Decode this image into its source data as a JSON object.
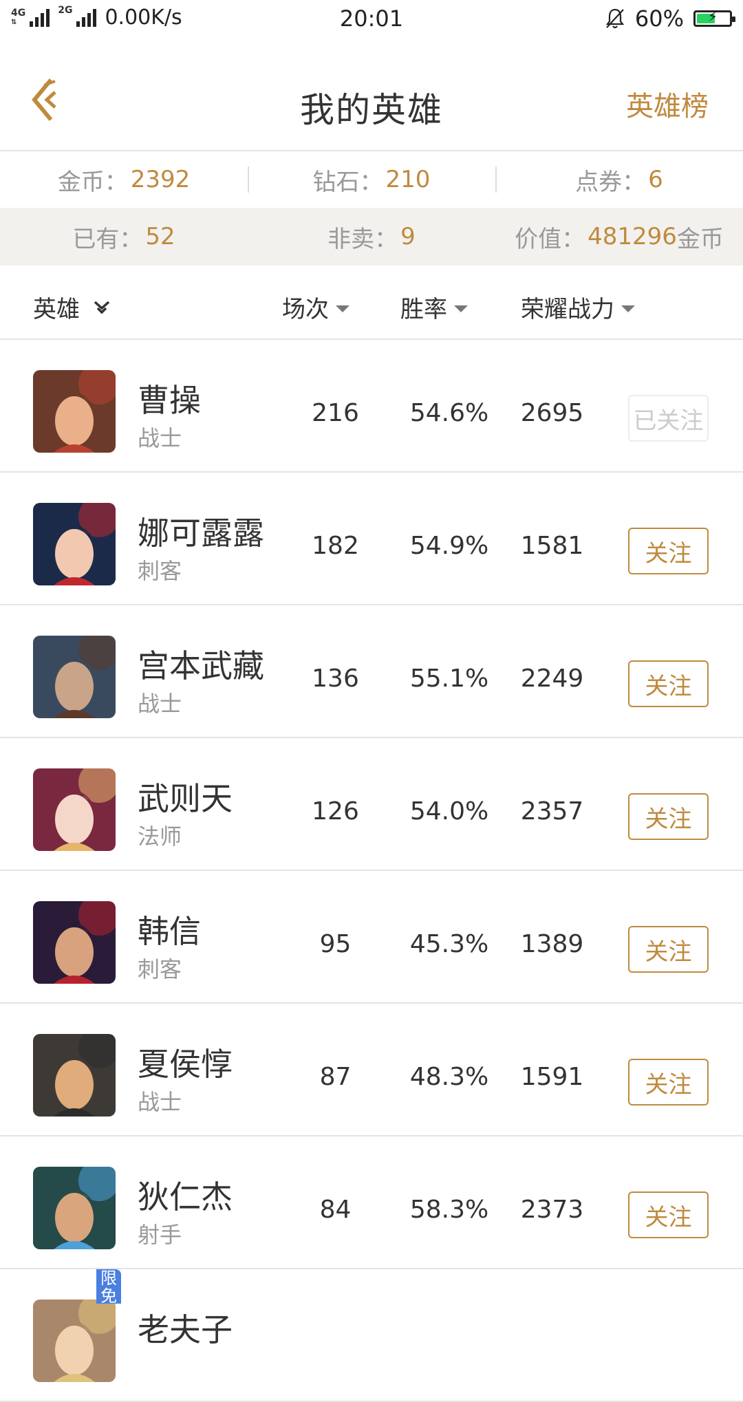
{
  "status_bar": {
    "net1": "4G",
    "net2": "4G",
    "net3": "2G",
    "speed": "0.00K/s",
    "time": "20:01",
    "battery": "60%",
    "battery_level": 0.6
  },
  "nav": {
    "title": "我的英雄",
    "right_link": "英雄榜"
  },
  "stats": {
    "gold_label": "金币：",
    "gold": "2392",
    "diamond_label": "钻石：",
    "diamond": "210",
    "voucher_label": "点券：",
    "voucher": "6",
    "owned_label": "已有：",
    "owned": "52",
    "notsale_label": "非卖：",
    "notsale": "9",
    "value_label": "价值：",
    "value": "481296",
    "value_suffix": "金币"
  },
  "table_header": {
    "hero": "英雄",
    "games": "场次",
    "winrate": "胜率",
    "power": "荣耀战力"
  },
  "heroes": [
    {
      "name": "曹操",
      "role": "战士",
      "games": "216",
      "winrate": "54.6%",
      "power": "2695",
      "follow": "已关注",
      "followed": true
    },
    {
      "name": "娜可露露",
      "role": "刺客",
      "games": "182",
      "winrate": "54.9%",
      "power": "1581",
      "follow": "关注",
      "followed": false
    },
    {
      "name": "宫本武藏",
      "role": "战士",
      "games": "136",
      "winrate": "55.1%",
      "power": "2249",
      "follow": "关注",
      "followed": false
    },
    {
      "name": "武则天",
      "role": "法师",
      "games": "126",
      "winrate": "54.0%",
      "power": "2357",
      "follow": "关注",
      "followed": false
    },
    {
      "name": "韩信",
      "role": "刺客",
      "games": "95",
      "winrate": "45.3%",
      "power": "1389",
      "follow": "关注",
      "followed": false
    },
    {
      "name": "夏侯惇",
      "role": "战士",
      "games": "87",
      "winrate": "48.3%",
      "power": "1591",
      "follow": "关注",
      "followed": false
    },
    {
      "name": "狄仁杰",
      "role": "射手",
      "games": "84",
      "winrate": "58.3%",
      "power": "2373",
      "follow": "关注",
      "followed": false
    },
    {
      "name": "老夫子",
      "role": "",
      "games": "",
      "winrate": "",
      "power": "",
      "follow": "",
      "followed": false,
      "badge": "限免"
    }
  ],
  "colors": {
    "accent": "#c08a3e",
    "muted": "#999999",
    "band": "#f2f1ee",
    "divider": "#e4e4e4",
    "badge": "#4a7fe0"
  }
}
